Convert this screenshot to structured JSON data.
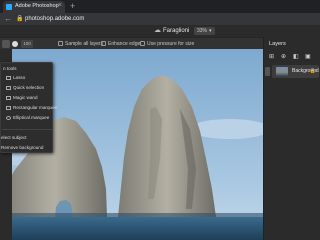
{
  "browser": {
    "tab_title": "Adobe Photoshop",
    "url": "photoshop.adobe.com"
  },
  "app": {
    "document_name": "Faraglioni",
    "zoom": "33%"
  },
  "options_bar": {
    "size": "100",
    "sample_all_layers": "Sample all layers",
    "enhance_edge": "Enhance edge",
    "use_pressure": "Use pressure for size"
  },
  "tool_menu": {
    "items": [
      {
        "label": "Lasso"
      },
      {
        "label": "Quick selection"
      },
      {
        "label": "Magic wand"
      },
      {
        "label": "Rectangular marquee"
      },
      {
        "label": "Elliptical marquee"
      }
    ],
    "header": "n tools",
    "select_subject": "elect subject",
    "remove_background": "Remove background"
  },
  "layers_panel": {
    "title": "Layers",
    "layers": [
      {
        "name": "Background"
      }
    ]
  },
  "colors": {
    "ui_dark": "#1e1e1e",
    "panel": "#2b2b2b",
    "accent": "#31a8ff",
    "sky": "#8fb7d8",
    "sea": "#2a4f6b"
  }
}
